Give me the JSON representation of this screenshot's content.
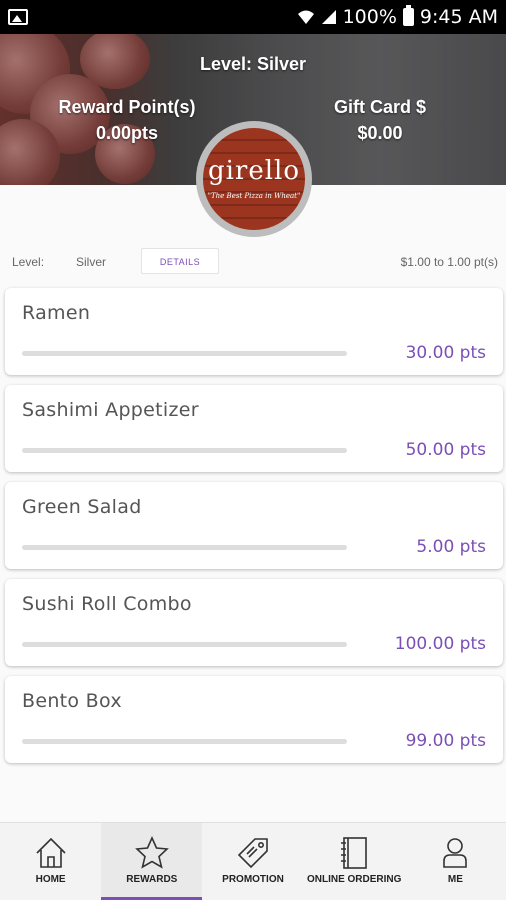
{
  "status_bar": {
    "battery": "100%",
    "time": "9:45 AM"
  },
  "header": {
    "level_title": "Level: Silver",
    "reward_points_label": "Reward Point(s)",
    "reward_points_value": "0.00pts",
    "gift_card_label": "Gift Card $",
    "gift_card_value": "$0.00"
  },
  "logo": {
    "name": "girello",
    "tagline": "\"The Best Pizza in Wheat\""
  },
  "level_row": {
    "label": "Level:",
    "value": "Silver",
    "details_button": "DETAILS",
    "rate": "$1.00 to 1.00 pt(s)"
  },
  "rewards": [
    {
      "name": "Ramen",
      "points": "30.00 pts",
      "progress": 0
    },
    {
      "name": "Sashimi Appetizer",
      "points": "50.00 pts",
      "progress": 0
    },
    {
      "name": "Green Salad",
      "points": "5.00 pts",
      "progress": 0
    },
    {
      "name": "Sushi Roll Combo",
      "points": "100.00 pts",
      "progress": 0
    },
    {
      "name": "Bento Box",
      "points": "99.00 pts",
      "progress": 0
    }
  ],
  "tabs": [
    {
      "label": "HOME",
      "icon": "home-icon"
    },
    {
      "label": "REWARDS",
      "icon": "star-icon",
      "active": true
    },
    {
      "label": "PROMOTION",
      "icon": "tag-icon"
    },
    {
      "label": "ONLINE ORDERING",
      "icon": "notebook-icon"
    },
    {
      "label": "ME",
      "icon": "person-icon"
    }
  ],
  "colors": {
    "accent": "#7b4fb5",
    "status_bar": "#000000",
    "logo_brick": "#a43a22"
  }
}
